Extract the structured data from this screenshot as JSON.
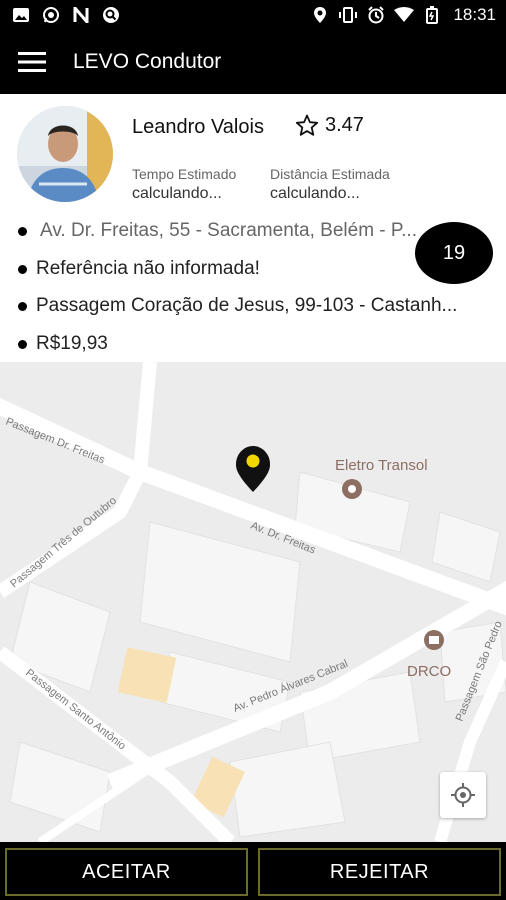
{
  "status_bar": {
    "time": "18:31",
    "left_icons": [
      "gallery-icon",
      "whatsapp-icon",
      "n-icon",
      "search-app-icon"
    ],
    "right_icons": [
      "location-icon",
      "vibrate-icon",
      "alarm-icon",
      "wifi-icon",
      "battery-icon"
    ]
  },
  "app_bar": {
    "title": "LEVO Condutor"
  },
  "driver": {
    "name": "Leandro Valois",
    "rating": "3.47",
    "estimated_time_label": "Tempo Estimado",
    "estimated_time_value": "calculando...",
    "estimated_distance_label": "Distância Estimada",
    "estimated_distance_value": "calculando..."
  },
  "trip": {
    "origin": "Av. Dr. Freitas, 55 - Sacramenta, Belém - P...",
    "reference": "Referência não informada!",
    "destination": "Passagem Coração de Jesus, 99-103 - Castanh...",
    "price": "R$19,93"
  },
  "countdown": "19",
  "map": {
    "labels": {
      "street1": "Passagem Dr. Freitas",
      "street2": "Passagem Três de Outubro",
      "street3": "Av. Dr. Freitas",
      "street4": "Av. Pedro Álvares Cabral",
      "street5": "Passagem Santo Antônio",
      "street6": "Passagem São Pedro",
      "poi1": "Eletro Transol",
      "poi2": "DRCO"
    },
    "colors": {
      "background": "#ececec",
      "road": "#ffffff",
      "poi": "#8d6e63",
      "pin": "#111111",
      "pin_dot": "#f2d600"
    }
  },
  "actions": {
    "accept": "ACEITAR",
    "reject": "REJEITAR"
  },
  "colors": {
    "button_border": "#6b6b2a"
  }
}
